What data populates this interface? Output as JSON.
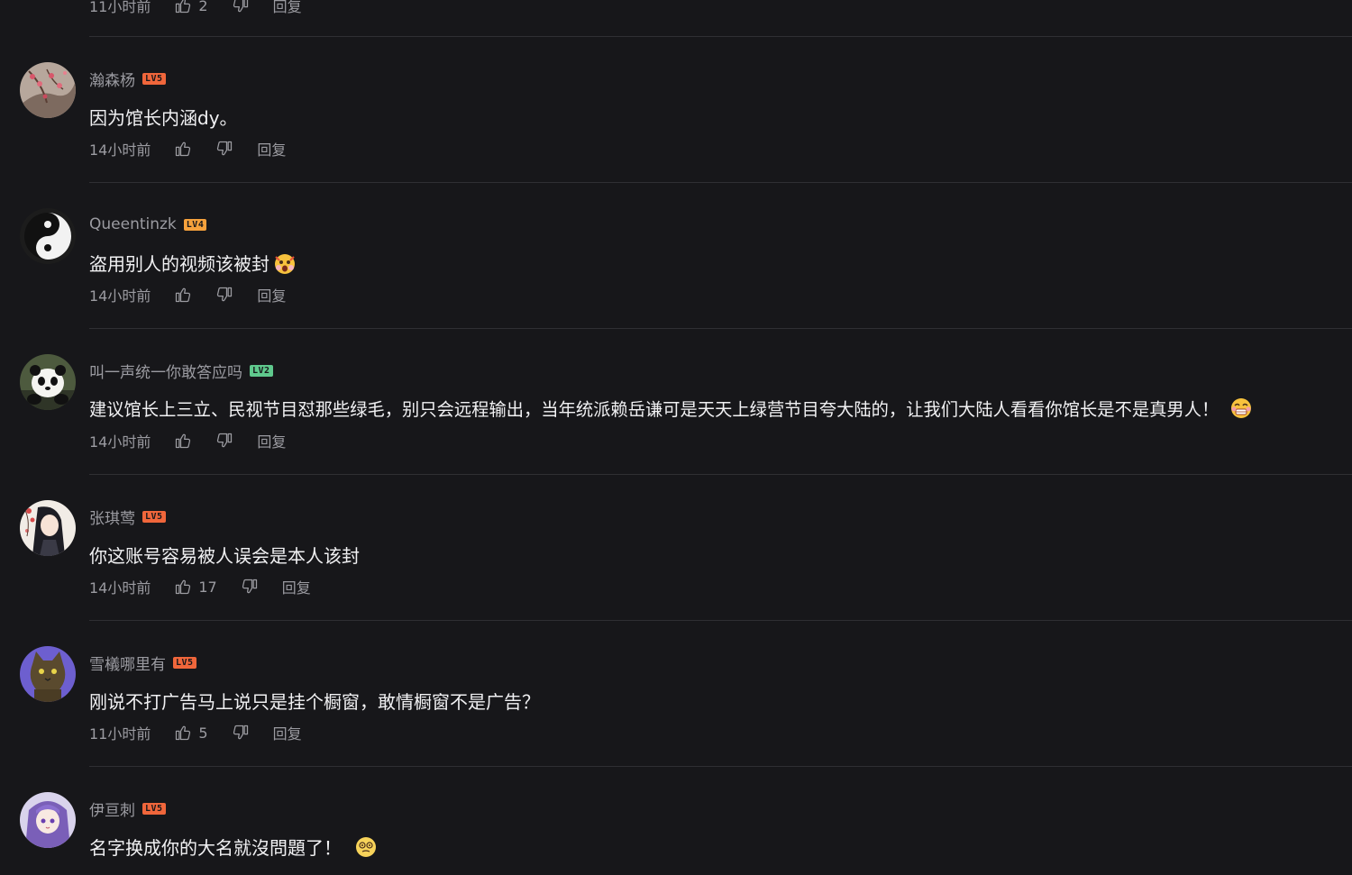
{
  "top_partial": {
    "time": "11小时前",
    "like_count": "2",
    "reply_label": "回复"
  },
  "comments": [
    {
      "username": "瀚森杨",
      "level": "LV5",
      "level_color": "#f0663b",
      "text": "因为馆长内涵dy。",
      "time": "14小时前",
      "like_count": "",
      "reply_label": "回复",
      "avatar": "avatar-plum-blossom"
    },
    {
      "username": "Queentinzk",
      "level": "LV4",
      "level_color": "#f5a13c",
      "text": "盗用别人的视频该被封",
      "emoji": "shocked-face-emoji",
      "time": "14小时前",
      "like_count": "",
      "reply_label": "回复",
      "avatar": "avatar-yin-yang"
    },
    {
      "username": "叫一声统一你敢答应吗",
      "level": "LV2",
      "level_color": "#5fc98d",
      "text": "建议馆长上三立、民视节目怼那些绿毛，别只会远程输出，当年统派赖岳谦可是天天上绿营节目夸大陆的，让我们大陆人看看你馆长是不是真男人！",
      "emoji": "grimace-face-emoji",
      "time": "14小时前",
      "like_count": "",
      "reply_label": "回复",
      "avatar": "avatar-panda"
    },
    {
      "username": "张琪莺",
      "level": "LV5",
      "level_color": "#f0663b",
      "text": "你这账号容易被人误会是本人该封",
      "time": "14小时前",
      "like_count": "17",
      "reply_label": "回复",
      "avatar": "avatar-anime-girl"
    },
    {
      "username": "雪檥哪里有",
      "level": "LV5",
      "level_color": "#f0663b",
      "text": "刚说不打广告马上说只是挂个橱窗，敢情橱窗不是广告？",
      "time": "11小时前",
      "like_count": "5",
      "reply_label": "回复",
      "avatar": "avatar-cat"
    },
    {
      "username": "伊亘刺",
      "level": "LV5",
      "level_color": "#f0663b",
      "text": "名字换成你的大名就沒問題了！",
      "emoji": "dizzy-face-emoji",
      "time": "",
      "like_count": "",
      "reply_label": "",
      "avatar": "avatar-purple-hair-girl"
    }
  ]
}
